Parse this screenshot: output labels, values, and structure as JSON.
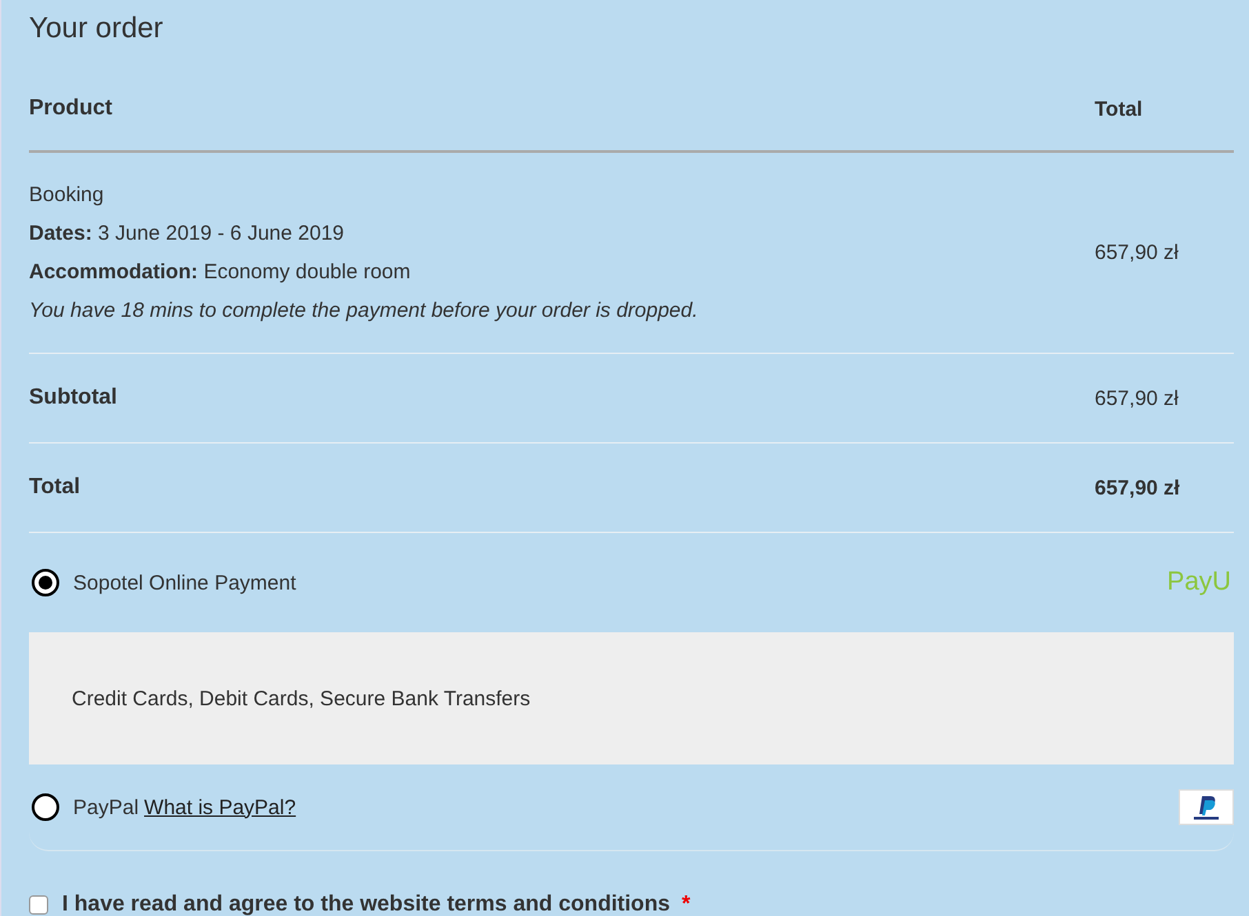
{
  "title": "Your order",
  "table": {
    "columns": [
      "Product",
      "Total"
    ],
    "item": {
      "name": "Booking",
      "details": [
        {
          "label": "Dates:",
          "value": "3 June 2019 - 6 June 2019"
        },
        {
          "label": "Accommodation:",
          "value": "Economy double room"
        }
      ],
      "note": "You have 18 mins to complete the payment before your order is dropped.",
      "total": "657,90 zł"
    },
    "subtotal": {
      "label": "Subtotal",
      "value": "657,90 zł"
    },
    "total": {
      "label": "Total",
      "value": "657,90 zł"
    }
  },
  "payment_methods": [
    {
      "kind": "text_logo",
      "label": "Sopotel Online Payment",
      "selected": true,
      "logo": "PayU",
      "description": "Credit Cards, Debit Cards, Secure Bank Transfers"
    },
    {
      "kind": "badge_logo",
      "label": "PayPal",
      "selected": false,
      "link": "What is PayPal?"
    }
  ],
  "terms": {
    "label": "I have read and agree to the website terms and conditions",
    "required": "*",
    "checked": false
  }
}
